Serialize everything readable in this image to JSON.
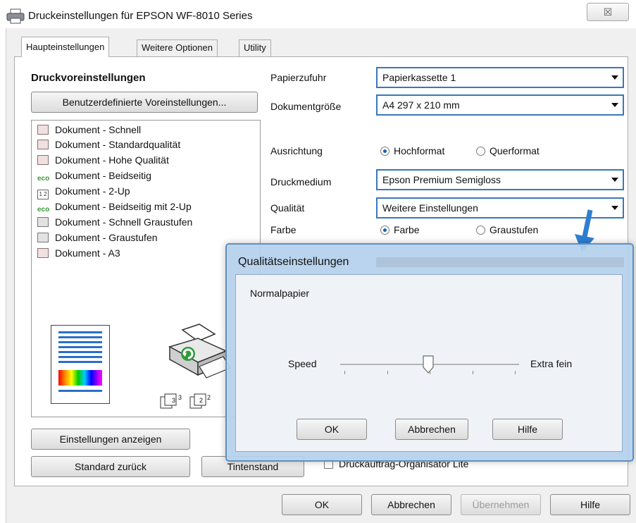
{
  "window": {
    "title": "Druckeinstellungen für EPSON WF-8010 Series",
    "close_glyph": "☒"
  },
  "tabs": [
    {
      "label": "Haupteinstellungen",
      "active": true
    },
    {
      "label": "Weitere Optionen",
      "active": false
    },
    {
      "label": "Utility",
      "active": false
    }
  ],
  "left": {
    "presets_heading": "Druckvoreinstellungen",
    "custom_presets_button": "Benutzerdefinierte Voreinstellungen...",
    "presets": [
      {
        "label": "Dokument - Schnell",
        "icon": "document-icon"
      },
      {
        "label": "Dokument - Standardqualität",
        "icon": "document-icon"
      },
      {
        "label": "Dokument - Hohe Qualität",
        "icon": "document-icon"
      },
      {
        "label": "Dokument - Beidseitig",
        "icon": "eco-icon"
      },
      {
        "label": "Dokument - 2-Up",
        "icon": "two-up-icon"
      },
      {
        "label": "Dokument - Beidseitig mit 2-Up",
        "icon": "eco-icon"
      },
      {
        "label": "Dokument - Schnell Graustufen",
        "icon": "grayscale-document-icon"
      },
      {
        "label": "Dokument - Graustufen",
        "icon": "grayscale-document-icon"
      },
      {
        "label": "Dokument - A3",
        "icon": "document-icon"
      }
    ],
    "eco_text": "eco",
    "two_up_text": "1 2",
    "copy_numbers": [
      "3",
      "3",
      "2",
      "2"
    ],
    "show_settings_button": "Einstellungen anzeigen",
    "reset_button": "Standard zurück",
    "ink_button": "Tintenstand",
    "organizer_checkbox": "Druckauftrag-Organisator Lite"
  },
  "right": {
    "paper_source_label": "Papierzufuhr",
    "paper_source_value": "Papierkassette 1",
    "doc_size_label": "Dokumentgröße",
    "doc_size_value": "A4 297 x 210 mm",
    "orientation_label": "Ausrichtung",
    "orientation_portrait": "Hochformat",
    "orientation_landscape": "Querformat",
    "orientation_selected": "Hochformat",
    "media_label": "Druckmedium",
    "media_value": "Epson Premium Semigloss",
    "quality_label": "Qualität",
    "quality_value": "Weitere Einstellungen",
    "color_label": "Farbe",
    "color_option": "Farbe",
    "grayscale_option": "Graustufen",
    "color_selected": "Farbe"
  },
  "footer": {
    "ok": "OK",
    "cancel": "Abbrechen",
    "apply": "Übernehmen",
    "help": "Hilfe"
  },
  "quality_dialog": {
    "title": "Qualitätseinstellungen",
    "media": "Normalpapier",
    "slider_min_label": "Speed",
    "slider_max_label": "Extra fein",
    "slider_level": 0.5,
    "ok": "OK",
    "cancel": "Abbrechen",
    "help": "Hilfe"
  },
  "colors": {
    "accent_border": "#3a78b8",
    "dialog_bg": "#b6d1ec",
    "arrow": "#2f7fd0"
  }
}
